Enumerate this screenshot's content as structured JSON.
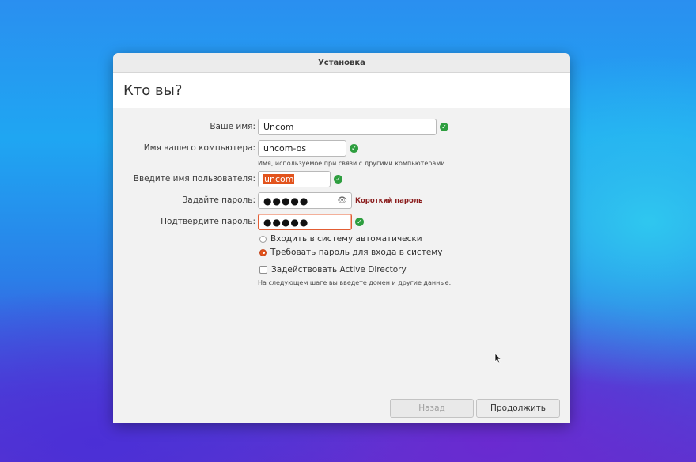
{
  "window": {
    "title": "Установка"
  },
  "page": {
    "heading": "Кто вы?"
  },
  "form": {
    "name_label": "Ваше имя:",
    "name_value": "Uncom",
    "computer_label": "Имя вашего компьютера:",
    "computer_value": "uncom-os",
    "computer_hint": "Имя, используемое при связи с другими компьютерами.",
    "username_label": "Введите имя пользователя:",
    "username_value": "uncom",
    "password_label": "Задайте пароль:",
    "password_value": "●●●●●",
    "password_warning": "Короткий пароль",
    "confirm_label": "Подтвердите пароль:",
    "confirm_value": "●●●●●",
    "login_auto": "Входить в систему автоматически",
    "login_require": "Требовать пароль для входа в систему",
    "login_selected": "require",
    "ad_label": "Задействовать Active Directory",
    "ad_checked": false,
    "ad_hint": "На следующем шаге вы введете домен и другие данные."
  },
  "buttons": {
    "back": "Назад",
    "continue": "Продолжить"
  },
  "progress": {
    "steps": 7,
    "accent": "#d0451e"
  },
  "colors": {
    "ok": "#2e9e3f",
    "accent": "#e2531c",
    "warning": "#8a1c1c"
  },
  "icons": {
    "ok": "check-circle-icon",
    "reveal": "eye-icon"
  }
}
